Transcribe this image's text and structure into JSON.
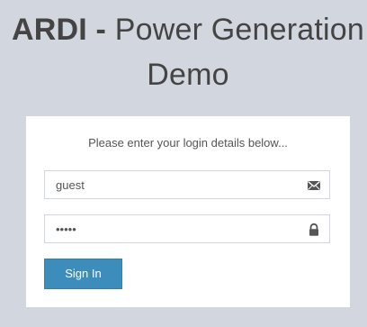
{
  "header": {
    "brand": "ARDI -",
    "title": "Power Generation Demo"
  },
  "login": {
    "message": "Please enter your login details below...",
    "username": {
      "value": "guest",
      "icon": "envelope-icon"
    },
    "password": {
      "value": "•••••",
      "icon": "lock-icon"
    },
    "signin_label": "Sign In"
  },
  "colors": {
    "background": "#d2d6de",
    "card": "#ffffff",
    "accent": "#3c8dbc",
    "text": "#444444"
  }
}
